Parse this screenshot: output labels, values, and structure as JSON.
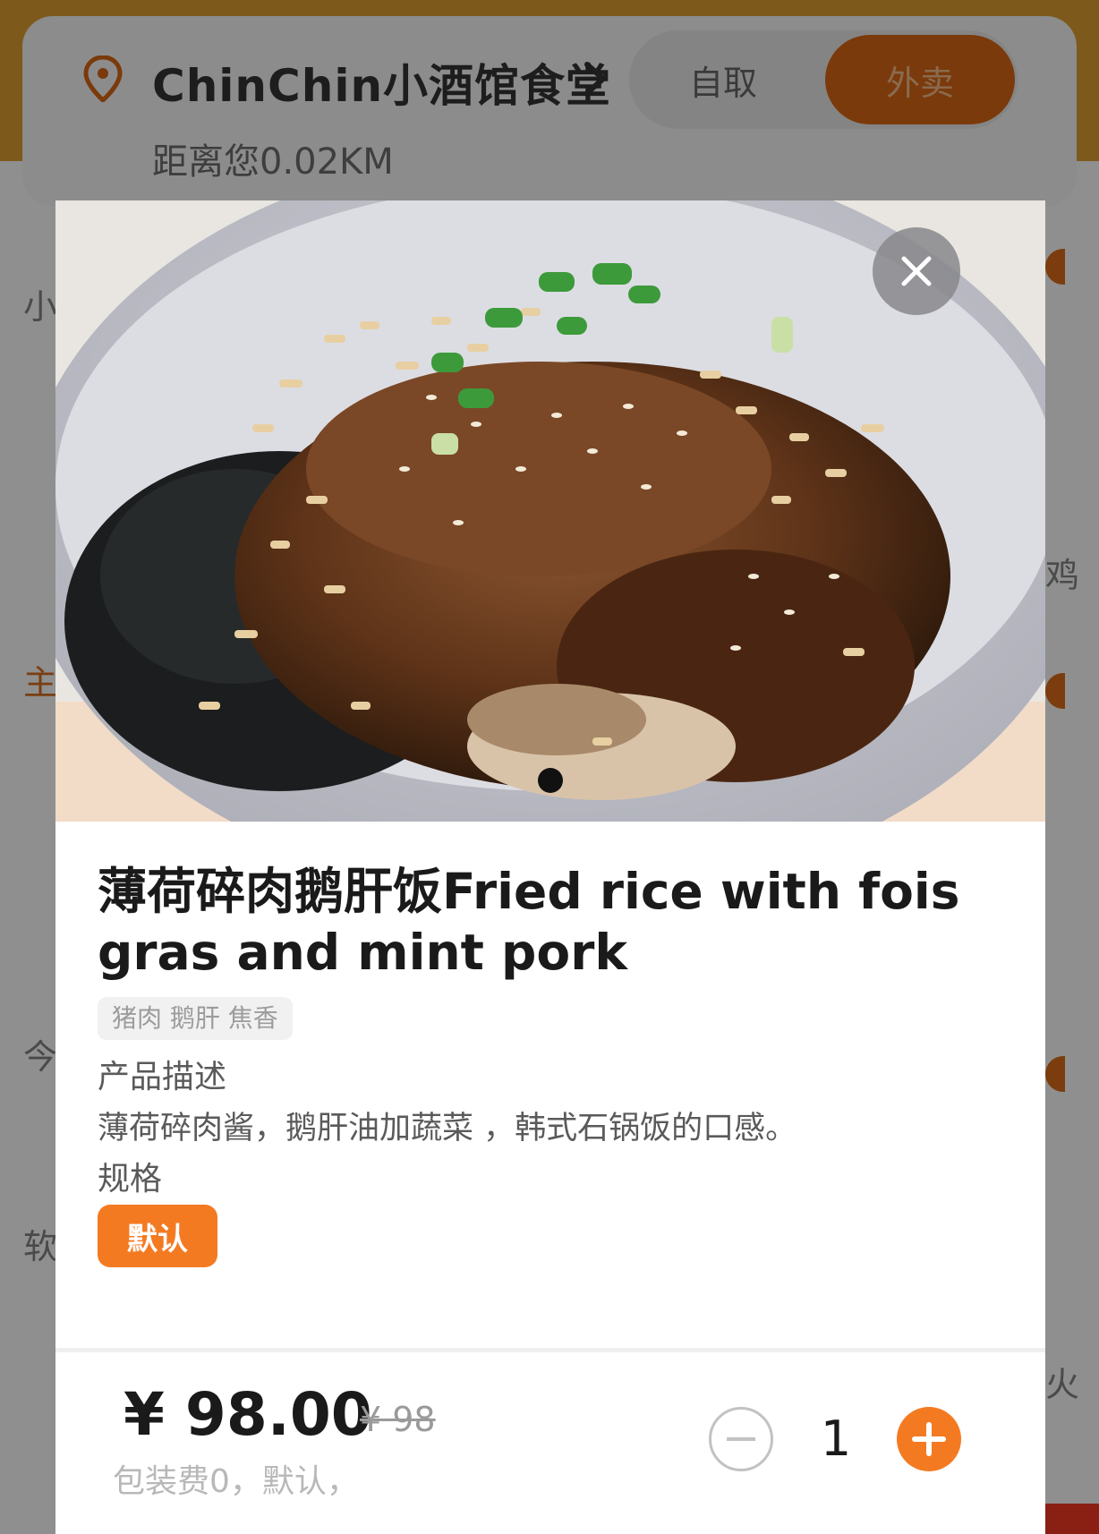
{
  "header": {
    "store_name": "ChinChin小酒馆食堂",
    "distance": "距离您0.02KM",
    "mode_pickup": "自取",
    "mode_delivery": "外卖",
    "active_mode": "外卖"
  },
  "background_side": {
    "left_chars": [
      "小",
      "主",
      "今",
      "软"
    ],
    "right_chars": [
      "鸡",
      "火"
    ]
  },
  "modal": {
    "image_alt": "rice bowl with pork, foie gras, sesame, seaweed and scallions",
    "carousel_index": 1,
    "title": "薄荷碎肉鹅肝饭Fried rice with fois gras and mint pork",
    "tags": "猪肉 鹅肝 焦香",
    "description_label": "产品描述",
    "description": "薄荷碎肉酱，鹅肝油加蔬菜 ，韩式石锅饭的口感。",
    "spec_label": "规格",
    "spec_option": "默认"
  },
  "footer": {
    "price": "¥ 98.00",
    "original_price": "¥ 98",
    "fee_note": "包装费0，默认，",
    "quantity": "1"
  },
  "colors": {
    "accent": "#f47a22",
    "text_primary": "#1a1a1a",
    "text_secondary": "#5a5a5a"
  },
  "icons": [
    "location-pin-icon",
    "chevron-right-icon",
    "close-icon",
    "minus-icon",
    "plus-icon"
  ]
}
